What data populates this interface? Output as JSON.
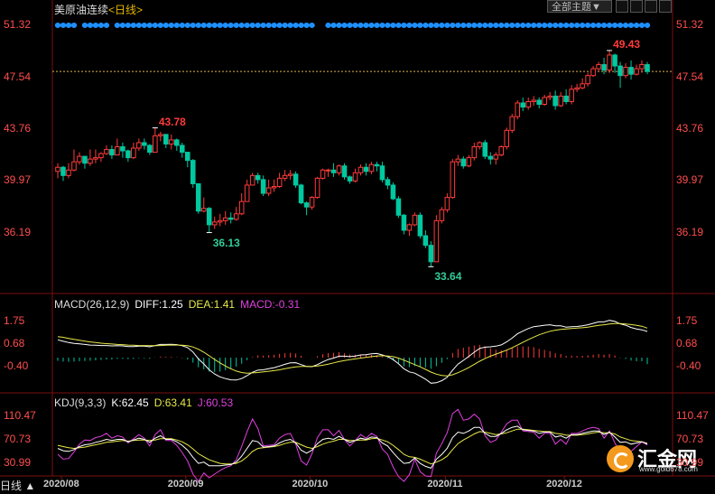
{
  "header": {
    "title": "美原油连续",
    "period": "<日线>",
    "theme_button": "全部主题▼",
    "bottom_tab": "日线 ▲"
  },
  "price_axis": {
    "ticks": [
      "51.32",
      "47.54",
      "43.76",
      "39.97",
      "36.19"
    ]
  },
  "macd_legend": {
    "name": "MACD(26,12,9)",
    "diff": "DIFF:1.25",
    "dea": "DEA:1.41",
    "macd": "MACD:-0.31"
  },
  "macd_axis": {
    "ticks": [
      "1.75",
      "0.68",
      "-0.40"
    ]
  },
  "kdj_legend": {
    "name": "KDJ(9,3,3)",
    "k": "K:62.45",
    "d": "D:63.41",
    "j": "J:60.53"
  },
  "kdj_axis": {
    "ticks": [
      "110.47",
      "70.73",
      "30.99"
    ]
  },
  "x_axis": {
    "labels": [
      "2020/08",
      "2020/09",
      "2020/10",
      "2020/11",
      "2020/12"
    ]
  },
  "annotations": {
    "high1": "43.78",
    "low1": "36.13",
    "low2": "33.64",
    "high2": "49.43"
  },
  "logo": {
    "name": "汇金网",
    "url": "www.gold678.com"
  },
  "colors": {
    "up": "#ff3b3b",
    "down": "#00c8a0",
    "diff": "#ffffff",
    "dea": "#e8e84a",
    "j": "#e040e0",
    "dots": "#1e90ff",
    "ref": "#d9b24a"
  },
  "chart_data": [
    {
      "type": "candlestick",
      "title": "美原油连续 <日线>",
      "ylim": [
        33.0,
        51.8
      ],
      "yticks": [
        36.19,
        39.97,
        43.76,
        47.54,
        51.32
      ],
      "reference_line": 47.9,
      "x_labels": [
        "2020/08",
        "2020/09",
        "2020/10",
        "2020/11",
        "2020/12"
      ],
      "annotations": [
        {
          "text": "43.78",
          "value": 43.78,
          "kind": "high"
        },
        {
          "text": "36.13",
          "value": 36.13,
          "kind": "low"
        },
        {
          "text": "33.64",
          "value": 33.64,
          "kind": "low"
        },
        {
          "text": "49.43",
          "value": 49.43,
          "kind": "high"
        }
      ],
      "close": [
        40.9,
        40.3,
        40.7,
        41.3,
        41.7,
        41.2,
        41.5,
        41.6,
        41.9,
        42.2,
        41.8,
        42.4,
        42.1,
        41.6,
        42.3,
        42.7,
        42.5,
        42.0,
        43.2,
        43.3,
        42.6,
        42.9,
        42.5,
        42.0,
        41.4,
        39.7,
        37.7,
        37.9,
        36.7,
        36.9,
        37.0,
        37.2,
        37.1,
        37.5,
        38.4,
        39.6,
        40.3,
        40.0,
        39.0,
        39.4,
        39.5,
        40.1,
        40.3,
        40.4,
        39.6,
        38.3,
        38.0,
        38.7,
        40.1,
        40.7,
        40.7,
        40.5,
        41.0,
        40.2,
        39.9,
        40.5,
        40.9,
        40.6,
        41.1,
        41.0,
        40.0,
        39.6,
        38.6,
        37.4,
        36.3,
        36.7,
        37.4,
        35.9,
        35.2,
        34.0,
        37.0,
        37.8,
        38.7,
        41.3,
        41.5,
        41.0,
        41.6,
        42.4,
        42.7,
        41.7,
        41.5,
        41.8,
        42.4,
        43.6,
        44.6,
        45.6,
        45.3,
        45.7,
        45.8,
        45.5,
        46.0,
        46.1,
        45.4,
        46.1,
        45.7,
        46.6,
        46.7,
        47.0,
        47.6,
        48.1,
        48.4,
        48.0,
        49.1,
        48.3,
        47.6,
        48.2,
        47.7,
        48.1,
        48.4,
        47.9
      ],
      "high": [
        41.2,
        41.0,
        41.2,
        42.2,
        42.0,
        41.5,
        42.2,
        42.2,
        42.0,
        42.5,
        42.5,
        43.0,
        42.7,
        42.2,
        42.7,
        43.0,
        43.0,
        42.6,
        43.8,
        43.5,
        43.0,
        43.3,
        43.0,
        42.7,
        42.0,
        41.5,
        39.7,
        38.7,
        38.0,
        37.3,
        37.5,
        37.7,
        37.6,
        38.0,
        39.0,
        40.0,
        40.5,
        40.5,
        40.3,
        40.0,
        40.0,
        40.5,
        40.7,
        40.7,
        40.6,
        39.7,
        38.4,
        38.8,
        40.2,
        40.8,
        40.8,
        41.2,
        41.1,
        41.2,
        40.3,
        40.8,
        41.1,
        41.2,
        41.3,
        41.3,
        41.3,
        40.2,
        39.8,
        38.8,
        37.5,
        36.8,
        37.6,
        37.6,
        36.3,
        35.5,
        37.4,
        38.0,
        39.0,
        41.5,
        41.8,
        41.7,
        41.8,
        42.7,
        42.8,
        42.9,
        42.0,
        42.0,
        42.5,
        43.8,
        44.8,
        45.8,
        46.0,
        46.0,
        46.1,
        46.0,
        46.2,
        46.4,
        46.5,
        46.4,
        46.6,
        46.9,
        47.0,
        47.4,
        47.8,
        48.3,
        48.6,
        48.9,
        49.43,
        49.2,
        48.6,
        48.5,
        48.7,
        48.4,
        48.7,
        48.6
      ],
      "low": [
        40.1,
        39.9,
        40.1,
        40.6,
        41.1,
        40.8,
        41.0,
        41.2,
        41.3,
        41.8,
        41.5,
        41.8,
        41.6,
        41.3,
        41.5,
        42.1,
        42.2,
        41.8,
        42.0,
        42.8,
        42.3,
        42.2,
        42.1,
        41.6,
        40.9,
        39.4,
        37.5,
        37.6,
        36.13,
        36.4,
        36.6,
        36.7,
        36.8,
        37.0,
        37.4,
        38.4,
        39.6,
        39.7,
        38.8,
        38.8,
        39.1,
        39.4,
        39.9,
        40.0,
        39.4,
        38.2,
        37.4,
        37.8,
        38.6,
        40.0,
        40.2,
        40.2,
        40.3,
        40.0,
        39.7,
        39.8,
        40.3,
        40.3,
        40.4,
        40.6,
        39.8,
        39.3,
        38.5,
        37.2,
        36.0,
        35.9,
        36.6,
        35.7,
        35.0,
        33.64,
        34.9,
        36.8,
        37.6,
        38.6,
        41.0,
        40.8,
        40.9,
        41.4,
        42.2,
        41.5,
        41.1,
        41.1,
        41.7,
        42.2,
        43.4,
        44.4,
        45.0,
        45.1,
        45.4,
        45.2,
        45.4,
        45.8,
        45.1,
        45.3,
        45.5,
        45.5,
        46.4,
        46.6,
        46.8,
        47.5,
        47.9,
        47.7,
        47.8,
        47.8,
        46.7,
        47.4,
        47.3,
        47.6,
        47.8,
        47.7
      ]
    },
    {
      "type": "bar",
      "title": "MACD(26,12,9)",
      "ylim": [
        -1.25,
        2.2
      ],
      "yticks": [
        -0.4,
        0.68,
        1.75
      ],
      "legend": [
        "DIFF:1.25",
        "DEA:1.41",
        "MACD:-0.31"
      ],
      "series": [
        {
          "name": "DIFF",
          "type": "line",
          "values": [
            0.85,
            0.78,
            0.72,
            0.68,
            0.66,
            0.63,
            0.6,
            0.59,
            0.58,
            0.58,
            0.56,
            0.57,
            0.56,
            0.53,
            0.53,
            0.55,
            0.55,
            0.52,
            0.58,
            0.63,
            0.63,
            0.64,
            0.62,
            0.57,
            0.48,
            0.27,
            -0.06,
            -0.3,
            -0.58,
            -0.78,
            -0.92,
            -1.0,
            -1.06,
            -1.07,
            -1.0,
            -0.86,
            -0.7,
            -0.6,
            -0.58,
            -0.53,
            -0.48,
            -0.4,
            -0.32,
            -0.25,
            -0.24,
            -0.33,
            -0.42,
            -0.43,
            -0.33,
            -0.2,
            -0.09,
            -0.02,
            0.07,
            0.07,
            0.05,
            0.08,
            0.13,
            0.14,
            0.18,
            0.2,
            0.13,
            0.05,
            -0.09,
            -0.29,
            -0.53,
            -0.68,
            -0.74,
            -0.88,
            -1.03,
            -1.22,
            -1.2,
            -1.1,
            -0.94,
            -0.6,
            -0.31,
            -0.13,
            0.06,
            0.26,
            0.44,
            0.5,
            0.52,
            0.55,
            0.61,
            0.75,
            0.93,
            1.14,
            1.27,
            1.39,
            1.48,
            1.51,
            1.55,
            1.57,
            1.52,
            1.52,
            1.46,
            1.48,
            1.49,
            1.52,
            1.57,
            1.64,
            1.71,
            1.71,
            1.78,
            1.73,
            1.61,
            1.55,
            1.44,
            1.37,
            1.33,
            1.25
          ]
        },
        {
          "name": "DEA",
          "type": "line",
          "values": [
            1.0,
            0.97,
            0.92,
            0.87,
            0.83,
            0.79,
            0.75,
            0.72,
            0.69,
            0.67,
            0.65,
            0.63,
            0.62,
            0.6,
            0.59,
            0.58,
            0.58,
            0.57,
            0.57,
            0.58,
            0.59,
            0.6,
            0.6,
            0.59,
            0.57,
            0.51,
            0.4,
            0.26,
            0.09,
            -0.09,
            -0.25,
            -0.4,
            -0.53,
            -0.64,
            -0.71,
            -0.74,
            -0.73,
            -0.71,
            -0.68,
            -0.65,
            -0.62,
            -0.58,
            -0.53,
            -0.48,
            -0.44,
            -0.42,
            -0.42,
            -0.42,
            -0.4,
            -0.36,
            -0.31,
            -0.25,
            -0.19,
            -0.14,
            -0.1,
            -0.06,
            -0.02,
            0.01,
            0.05,
            0.08,
            0.09,
            0.08,
            0.05,
            -0.02,
            -0.12,
            -0.23,
            -0.33,
            -0.44,
            -0.56,
            -0.69,
            -0.79,
            -0.85,
            -0.87,
            -0.82,
            -0.72,
            -0.6,
            -0.47,
            -0.32,
            -0.17,
            -0.04,
            0.07,
            0.17,
            0.26,
            0.36,
            0.47,
            0.6,
            0.73,
            0.86,
            0.98,
            1.09,
            1.18,
            1.26,
            1.31,
            1.35,
            1.37,
            1.39,
            1.41,
            1.43,
            1.46,
            1.5,
            1.54,
            1.57,
            1.61,
            1.63,
            1.63,
            1.61,
            1.58,
            1.54,
            1.5,
            1.41
          ]
        },
        {
          "name": "MACD",
          "type": "bar",
          "values": [
            -0.15,
            -0.19,
            -0.2,
            -0.19,
            -0.17,
            -0.16,
            -0.15,
            -0.13,
            -0.11,
            -0.09,
            -0.09,
            -0.06,
            -0.06,
            -0.07,
            -0.06,
            -0.03,
            -0.03,
            -0.05,
            0.01,
            0.05,
            0.04,
            0.04,
            0.02,
            -0.02,
            -0.09,
            -0.24,
            -0.46,
            -0.56,
            -0.67,
            -0.69,
            -0.67,
            -0.6,
            -0.53,
            -0.43,
            -0.29,
            -0.12,
            0.03,
            0.11,
            0.1,
            0.12,
            0.14,
            0.18,
            0.21,
            0.23,
            0.2,
            0.09,
            0.0,
            -0.01,
            0.07,
            0.16,
            0.22,
            0.23,
            0.26,
            0.21,
            0.15,
            0.14,
            0.15,
            0.13,
            0.13,
            0.12,
            0.04,
            -0.03,
            -0.14,
            -0.27,
            -0.41,
            -0.45,
            -0.41,
            -0.44,
            -0.47,
            -0.53,
            -0.41,
            -0.25,
            -0.07,
            0.22,
            0.41,
            0.47,
            0.53,
            0.58,
            0.61,
            0.54,
            0.45,
            0.38,
            0.35,
            0.39,
            0.46,
            0.54,
            0.54,
            0.53,
            0.5,
            0.42,
            0.37,
            0.31,
            0.21,
            0.17,
            0.09,
            0.09,
            0.08,
            0.09,
            0.11,
            0.14,
            0.17,
            0.14,
            0.17,
            0.1,
            -0.02,
            -0.06,
            -0.14,
            -0.17,
            -0.17,
            -0.31
          ]
        }
      ]
    },
    {
      "type": "line",
      "title": "KDJ(9,3,3)",
      "ylim": [
        12,
        122
      ],
      "yticks": [
        30.99,
        70.73,
        110.47
      ],
      "legend": [
        "K:62.45",
        "D:63.41",
        "J:60.53"
      ],
      "series": [
        {
          "name": "K",
          "values": [
            55,
            51,
            50,
            53,
            58,
            61,
            62,
            65,
            67,
            70,
            68,
            70,
            70,
            66,
            69,
            72,
            70,
            65,
            72,
            76,
            70,
            70,
            66,
            60,
            52,
            40,
            30,
            32,
            26,
            26,
            26,
            27,
            28,
            32,
            42,
            55,
            68,
            66,
            57,
            58,
            59,
            64,
            68,
            70,
            64,
            52,
            47,
            52,
            63,
            70,
            72,
            70,
            75,
            70,
            65,
            68,
            72,
            70,
            74,
            73,
            64,
            59,
            48,
            38,
            30,
            31,
            39,
            30,
            25,
            22,
            37,
            45,
            55,
            73,
            82,
            80,
            84,
            90,
            90,
            80,
            75,
            75,
            80,
            86,
            90,
            92,
            86,
            85,
            84,
            80,
            82,
            82,
            74,
            76,
            72,
            78,
            78,
            80,
            82,
            84,
            84,
            78,
            82,
            74,
            65,
            66,
            62,
            64,
            66,
            62.45
          ]
        },
        {
          "name": "D",
          "values": [
            60,
            58,
            56,
            55,
            56,
            57,
            59,
            61,
            63,
            65,
            66,
            67,
            68,
            67,
            68,
            69,
            69,
            68,
            69,
            71,
            71,
            71,
            69,
            66,
            61,
            54,
            46,
            41,
            36,
            33,
            30,
            29,
            29,
            30,
            34,
            41,
            50,
            55,
            56,
            57,
            58,
            60,
            63,
            65,
            65,
            61,
            57,
            55,
            58,
            62,
            65,
            67,
            70,
            70,
            68,
            68,
            69,
            69,
            71,
            72,
            69,
            66,
            60,
            53,
            45,
            41,
            40,
            37,
            33,
            29,
            32,
            36,
            42,
            53,
            63,
            69,
            74,
            79,
            83,
            82,
            80,
            78,
            79,
            81,
            84,
            87,
            87,
            86,
            85,
            84,
            83,
            83,
            80,
            79,
            77,
            77,
            77,
            78,
            79,
            81,
            82,
            81,
            81,
            79,
            74,
            71,
            68,
            67,
            66,
            63.41
          ]
        },
        {
          "name": "J",
          "values": [
            45,
            37,
            38,
            49,
            62,
            69,
            68,
            73,
            75,
            80,
            72,
            76,
            74,
            64,
            71,
            78,
            72,
            59,
            78,
            86,
            68,
            68,
            60,
            48,
            34,
            12,
            0,
            14,
            6,
            12,
            18,
            23,
            26,
            36,
            58,
            83,
            104,
            88,
            59,
            60,
            61,
            72,
            78,
            80,
            62,
            34,
            27,
            46,
            73,
            86,
            86,
            76,
            85,
            70,
            59,
            68,
            78,
            72,
            80,
            75,
            54,
            45,
            24,
            8,
            0,
            11,
            37,
            16,
            9,
            8,
            47,
            63,
            81,
            113,
            120,
            102,
            104,
            112,
            104,
            76,
            65,
            69,
            82,
            96,
            102,
            102,
            84,
            83,
            82,
            72,
            80,
            80,
            62,
            70,
            62,
            80,
            80,
            84,
            88,
            90,
            88,
            72,
            84,
            64,
            47,
            56,
            50,
            58,
            66,
            60.53
          ]
        }
      ]
    }
  ]
}
